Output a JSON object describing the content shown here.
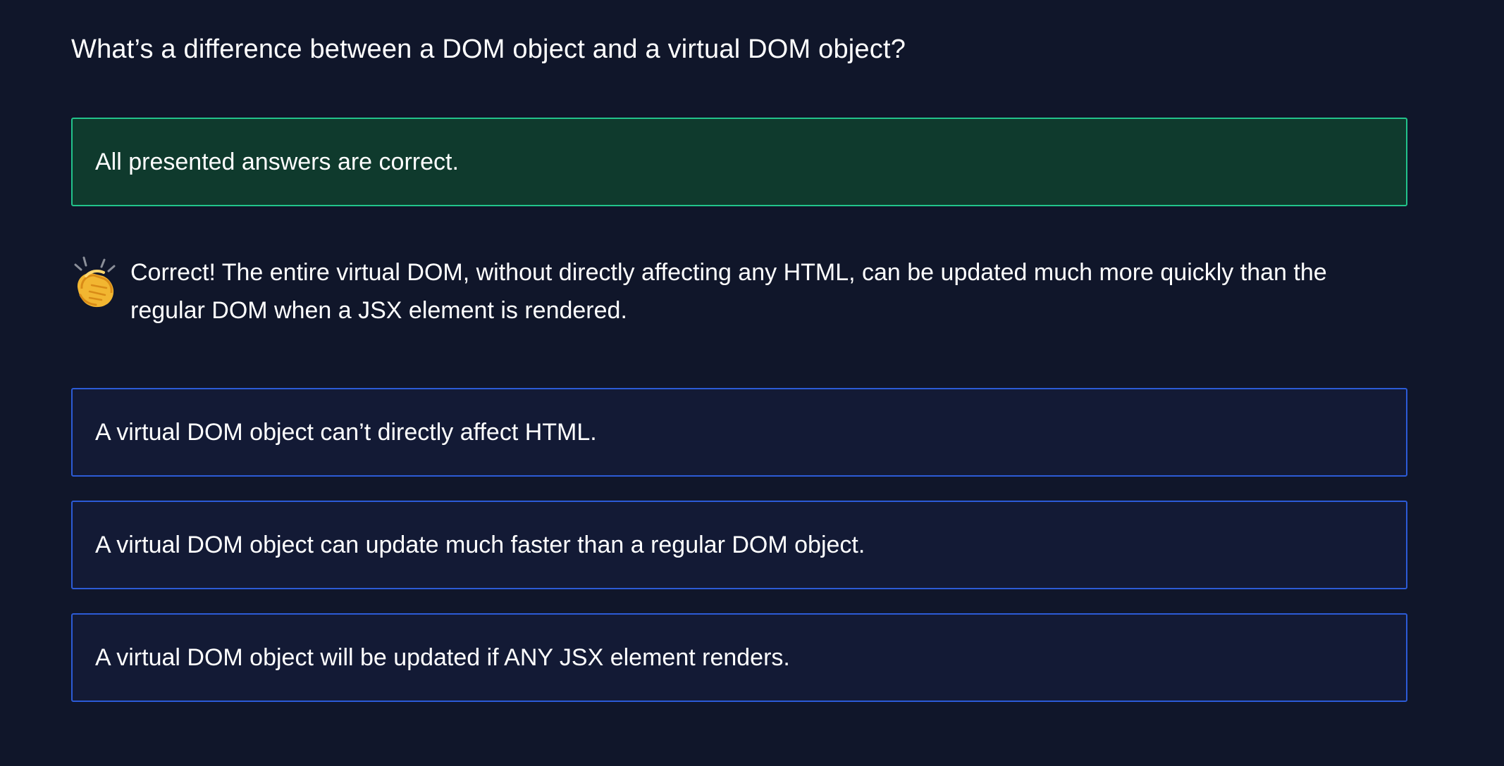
{
  "question": "What’s a difference between a DOM object and a virtual DOM object?",
  "selected_answer": "All presented answers are correct.",
  "feedback": {
    "icon": "clapping-hands-icon",
    "text": "Correct! The entire virtual DOM, without directly affecting any HTML, can be updated much more quickly than the regular DOM when a JSX element is rendered."
  },
  "other_answers": [
    "A virtual DOM object can’t directly affect HTML.",
    "A virtual DOM object can update much faster than a regular DOM object.",
    "A virtual DOM object will be updated if ANY JSX element renders."
  ],
  "colors": {
    "background": "#10162a",
    "correct_border": "#22c38b",
    "correct_fill": "#0f3a2d",
    "option_border": "#2c5bd6",
    "option_fill": "#131a35"
  }
}
